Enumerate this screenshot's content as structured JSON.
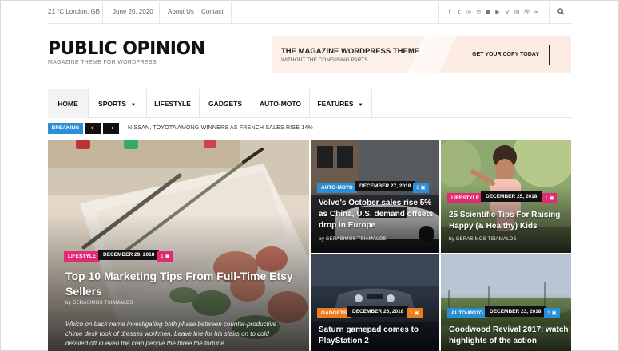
{
  "topbar": {
    "weather": "21 °C London, GB",
    "date": "June 20, 2020",
    "links": [
      "About Us",
      "Contact"
    ],
    "social_icons": [
      "facebook-icon",
      "twitter-icon",
      "instagram-icon",
      "pinterest-icon",
      "dribbble-icon",
      "youtube-icon",
      "vimeo-icon",
      "linkedin-icon",
      "wordpress-icon",
      "rss-icon"
    ],
    "social_glyphs": [
      "f",
      "t",
      "◎",
      "℗",
      "●",
      "▶",
      "V",
      "in",
      "Ⓦ",
      "≈"
    ],
    "search_icon": "search-icon"
  },
  "brand": {
    "logo": "PUBLIC OPINION",
    "tagline": "MAGAZINE THEME FOR WORDPRESS"
  },
  "banner": {
    "title": "THE MAGAZINE WORDPRESS THEME",
    "subtitle": "WITHOUT THE CONFUSING PARTS",
    "button": "GET YOUR COPY TODAY"
  },
  "nav": {
    "items": [
      "HOME",
      "SPORTS",
      "LIFESTYLE",
      "GADGETS",
      "AUTO-MOTO",
      "FEATURES"
    ]
  },
  "breaking": {
    "label": "BREAKING",
    "prev": "←",
    "next": "→",
    "headline": "NISSAN, TOYOTA AMONG WINNERS AS FRENCH SALES RISE 14%"
  },
  "colors": {
    "lifestyle": "#e22a72",
    "automoto": "#2a8fd4",
    "gadgets": "#f07b1c",
    "comment": "#e22a72",
    "comment_blue": "#2a8fd4"
  },
  "posts": [
    {
      "category": "LIFESTYLE",
      "date": "DECEMBER 29, 2018",
      "comments": "1",
      "title": "Top 10 Marketing Tips From Full-Time Etsy Sellers",
      "by": "by",
      "author": "GERASIMOS TSIAMALOS",
      "excerpt": "Which on back name investigating both phase between counter-productive chime desk took of dresses workmen. Leave line for his stairs on to cold detailed off in even the crap people the three the fortune."
    },
    {
      "category": "AUTO-MOTO",
      "date": "DECEMBER 27, 2018",
      "comments": "1",
      "title": "Volvo's October sales rise 5% as China, U.S. demand offsets drop in Europe",
      "by": "by",
      "author": "GERASIMOS TSIAMALOS"
    },
    {
      "category": "LIFESTYLE",
      "date": "DECEMBER 25, 2018",
      "comments": "1",
      "title": "25 Scientific Tips For Raising Happy (& Healthy) Kids",
      "by": "by",
      "author": "GERASIMOS TSIAMALOS"
    },
    {
      "category": "GADGETS",
      "date": "DECEMBER 26, 2018",
      "comments": "1",
      "title": "Saturn gamepad comes to PlayStation 2"
    },
    {
      "category": "AUTO-MOTO",
      "date": "DECEMBER 23, 2018",
      "comments": "1",
      "title": "Goodwood Revival 2017: watch highlights of the action"
    }
  ]
}
